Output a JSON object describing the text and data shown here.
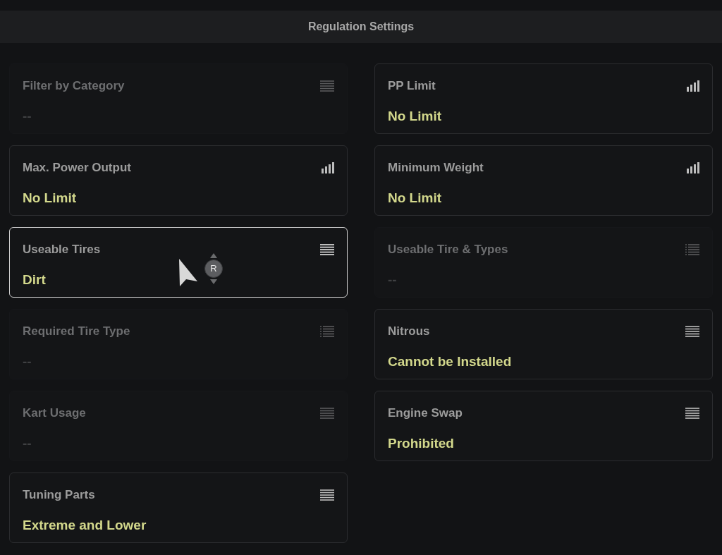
{
  "header": {
    "title": "Regulation Settings"
  },
  "settings": [
    {
      "label": "Filter by Category",
      "value": "--",
      "kind": "lines",
      "disabled": true,
      "selected": false
    },
    {
      "label": "PP Limit",
      "value": "No Limit",
      "kind": "bars",
      "disabled": false,
      "selected": false
    },
    {
      "label": "Max. Power Output",
      "value": "No Limit",
      "kind": "bars",
      "disabled": false,
      "selected": false
    },
    {
      "label": "Minimum Weight",
      "value": "No Limit",
      "kind": "bars",
      "disabled": false,
      "selected": false
    },
    {
      "label": "Useable Tires",
      "value": "Dirt",
      "kind": "lines",
      "disabled": false,
      "selected": true
    },
    {
      "label": "Useable Tire & Types",
      "value": "--",
      "kind": "list",
      "disabled": true,
      "selected": false
    },
    {
      "label": "Required Tire Type",
      "value": "--",
      "kind": "list",
      "disabled": true,
      "selected": false
    },
    {
      "label": "Nitrous",
      "value": "Cannot be Installed",
      "kind": "lines",
      "disabled": false,
      "selected": false
    },
    {
      "label": "Kart Usage",
      "value": "--",
      "kind": "lines",
      "disabled": true,
      "selected": false
    },
    {
      "label": "Engine Swap",
      "value": "Prohibited",
      "kind": "lines",
      "disabled": false,
      "selected": false
    },
    {
      "label": "Tuning Parts",
      "value": "Extreme and Lower",
      "kind": "lines",
      "disabled": false,
      "selected": false
    }
  ],
  "cursor": {
    "button": "R"
  }
}
